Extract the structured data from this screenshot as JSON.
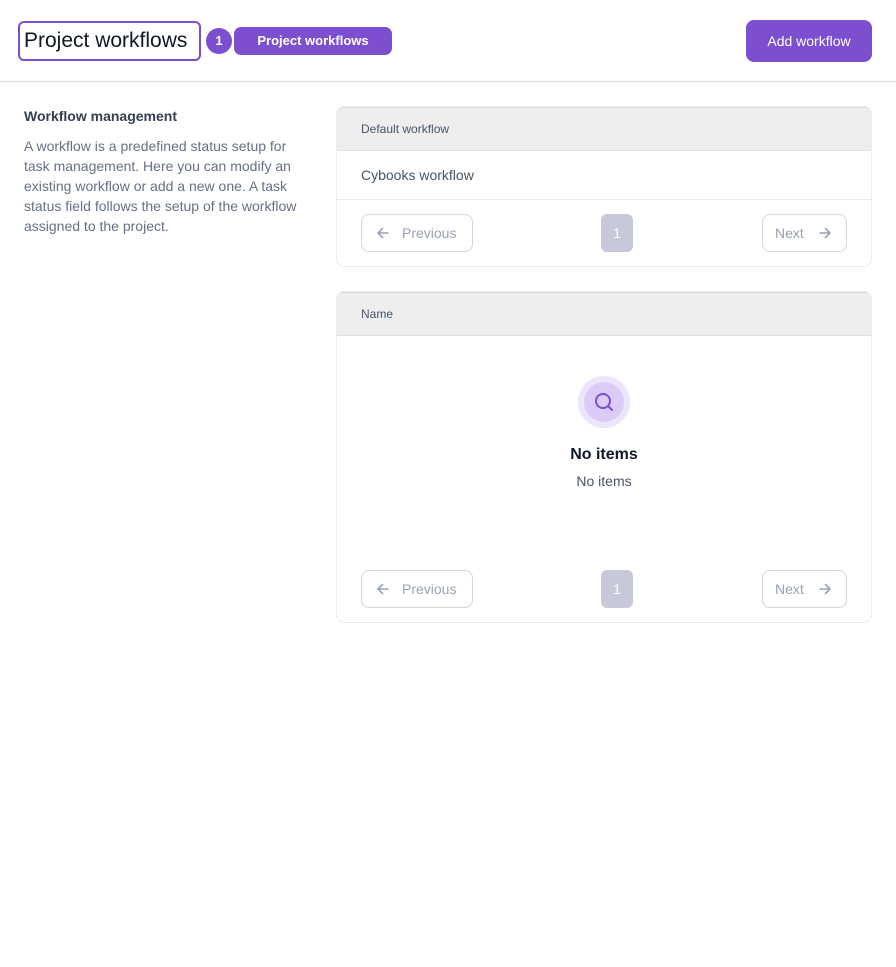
{
  "header": {
    "title": "Project workflows",
    "count": "1",
    "label_pill": "Project workflows",
    "add_button": "Add workflow"
  },
  "sidebar": {
    "title": "Workflow management",
    "description": "A workflow is a predefined status setup for task management. Here you can modify an existing workflow or add a new one. A task status field follows the setup of the workflow assigned to the project."
  },
  "default_table": {
    "column_header": "Default workflow",
    "rows": [
      "Cybooks workflow"
    ],
    "pagination": {
      "previous": "Previous",
      "page": "1",
      "next": "Next"
    }
  },
  "workflows_table": {
    "column_header": "Name",
    "empty_title": "No items",
    "empty_subtitle": "No items",
    "pagination": {
      "previous": "Previous",
      "page": "1",
      "next": "Next"
    }
  },
  "icons": {
    "prev": "arrow-left-icon",
    "next": "arrow-right-icon",
    "empty": "search-icon"
  },
  "colors": {
    "accent": "#7b4fcf",
    "disabled_page": "#c7c9d9",
    "table_header_bg": "#eeeeee"
  }
}
